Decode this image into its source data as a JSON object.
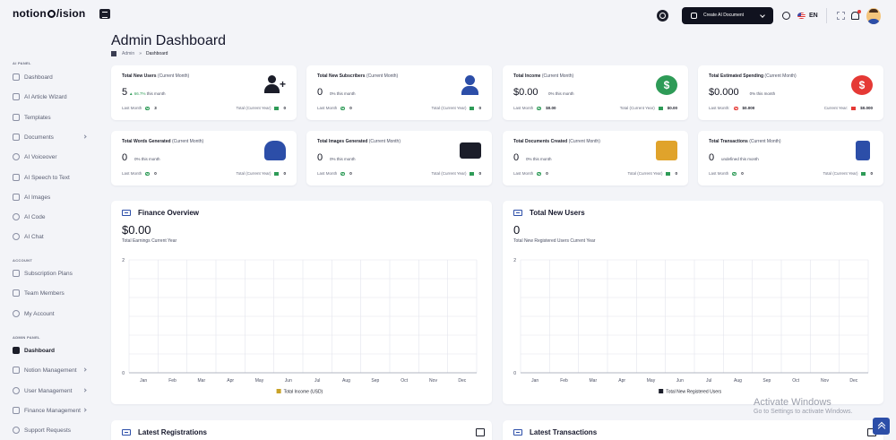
{
  "app": {
    "logo_left": "notion",
    "logo_right": "ision"
  },
  "header": {
    "create_label": "Create AI Document",
    "lang": "EN"
  },
  "sidebar": {
    "ai_panel_title": "AI PANEL",
    "ai_items": [
      {
        "label": "Dashboard"
      },
      {
        "label": "AI Article Wizard"
      },
      {
        "label": "Templates"
      },
      {
        "label": "Documents"
      },
      {
        "label": "AI Voiceover"
      },
      {
        "label": "AI Speech to Text"
      },
      {
        "label": "AI Images"
      },
      {
        "label": "AI Code"
      },
      {
        "label": "AI Chat"
      }
    ],
    "account_title": "ACCOUNT",
    "account_items": [
      {
        "label": "Subscription Plans"
      },
      {
        "label": "Team Members"
      },
      {
        "label": "My Account"
      }
    ],
    "admin_title": "ADMIN PANEL",
    "admin_items": [
      {
        "label": "Dashboard"
      },
      {
        "label": "Notion Management"
      },
      {
        "label": "User Management"
      },
      {
        "label": "Finance Management"
      },
      {
        "label": "Support Requests"
      }
    ]
  },
  "page": {
    "title": "Admin Dashboard",
    "crumb_root": "Admin",
    "crumb_sep": "»",
    "crumb_current": "Dashboard"
  },
  "stats": [
    {
      "label": "Total New Users",
      "period": "(Current Month)",
      "value": "5",
      "change_pct": "66.7%",
      "change_text": "this month",
      "last_month_label": "Last Month",
      "last_month": "3",
      "total_label": "Total (Current Year)",
      "total": "0"
    },
    {
      "label": "Total New Subscribers",
      "period": "(Current Month)",
      "value": "0",
      "change_pct": "0%",
      "change_text": "this month",
      "last_month_label": "Last Month",
      "last_month": "0",
      "total_label": "Total (Current Year)",
      "total": "0"
    },
    {
      "label": "Total Income",
      "period": "(Current Month)",
      "value": "$0.00",
      "change_pct": "0%",
      "change_text": "this month",
      "last_month_label": "Last Month",
      "last_month": "$0.00",
      "total_label": "Total (Current Year)",
      "total": "$0.00"
    },
    {
      "label": "Total Estimated Spending",
      "period": "(Current Month)",
      "value": "$0.000",
      "change_pct": "0%",
      "change_text": "this month",
      "last_month_label": "Last Month:",
      "last_month": "$0.000",
      "total_label": "Current Year:",
      "total": "$0.000"
    },
    {
      "label": "Total Words Generated",
      "period": "(Current Month)",
      "value": "0",
      "change_pct": "0%",
      "change_text": "this month",
      "last_month_label": "Last Month",
      "last_month": "0",
      "total_label": "Total (Current Year)",
      "total": "0"
    },
    {
      "label": "Total Images Generated",
      "period": "(Current Month)",
      "value": "0",
      "change_pct": "0%",
      "change_text": "this month",
      "last_month_label": "Last Month",
      "last_month": "0",
      "total_label": "Total (Current Year)",
      "total": "0"
    },
    {
      "label": "Total Documents Created",
      "period": "(Current Month)",
      "value": "0",
      "change_pct": "0%",
      "change_text": "this month",
      "last_month_label": "Last Month",
      "last_month": "0",
      "total_label": "Total (Current Year)",
      "total": "0"
    },
    {
      "label": "Total Transactions",
      "period": "(Current Month)",
      "value": "0",
      "change_pct": "undefined",
      "change_text": "this month",
      "last_month_label": "Last Month",
      "last_month": "0",
      "total_label": "Total (Current Year)",
      "total": "0"
    }
  ],
  "finance": {
    "title": "Finance Overview",
    "value": "$0.00",
    "subtitle": "Total Earnings Current Year"
  },
  "new_users": {
    "title": "Total New Users",
    "value": "0",
    "subtitle": "Total New Registered Users Current Year"
  },
  "latest": {
    "registrations": "Latest Registrations",
    "transactions": "Latest Transactions"
  },
  "watermark": {
    "line1": "Activate Windows",
    "line2": "Go to Settings to activate Windows."
  },
  "colors": {
    "accent": "#2c4ea8",
    "green": "#2e9b57",
    "red": "#e53935",
    "income_legend": "#c9a227",
    "users_legend": "#1b1d29"
  },
  "chart_data": [
    {
      "type": "bar",
      "categories": [
        "Jan",
        "Feb",
        "Mar",
        "Apr",
        "May",
        "Jun",
        "Jul",
        "Aug",
        "Sep",
        "Oct",
        "Nov",
        "Dec"
      ],
      "series": [
        {
          "name": "Total Income (USD)",
          "values": [
            0,
            0,
            0,
            0,
            0,
            0,
            0,
            0,
            0,
            0,
            0,
            0
          ]
        }
      ],
      "ylim": [
        0,
        2
      ],
      "yticks": [
        "0",
        "2"
      ],
      "grid": true,
      "legend": "bottom"
    },
    {
      "type": "bar",
      "categories": [
        "Jan",
        "Feb",
        "Mar",
        "Apr",
        "May",
        "Jun",
        "Jul",
        "Aug",
        "Sep",
        "Oct",
        "Nov",
        "Dec"
      ],
      "series": [
        {
          "name": "Total New Registered Users",
          "values": [
            0,
            0,
            0,
            0,
            0,
            0,
            0,
            0,
            0,
            0,
            0,
            0
          ]
        }
      ],
      "ylim": [
        0,
        2
      ],
      "yticks": [
        "0",
        "2"
      ],
      "grid": true,
      "legend": "bottom"
    }
  ]
}
